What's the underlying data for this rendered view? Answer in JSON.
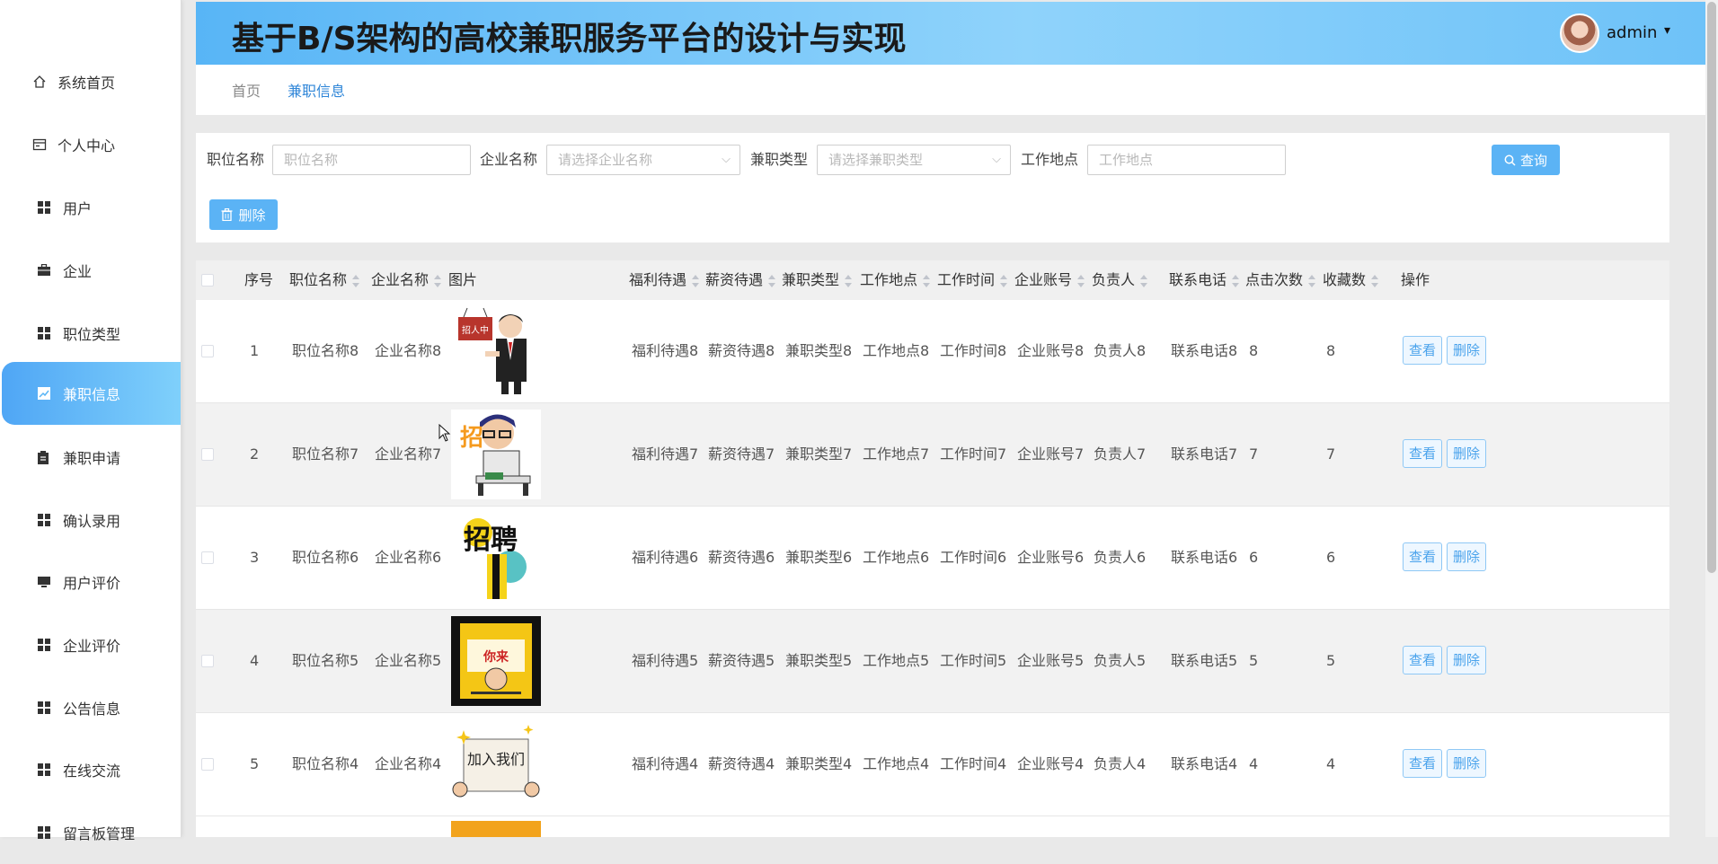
{
  "header": {
    "title": "基于B/S架构的高校兼职服务平台的设计与实现",
    "user": "admin",
    "caret": "▾"
  },
  "sidebar": {
    "items": [
      {
        "label": "系统首页",
        "icon": "home-icon"
      },
      {
        "label": "个人中心",
        "icon": "profile-card-icon"
      },
      {
        "label": "用户",
        "icon": "grid-icon"
      },
      {
        "label": "企业",
        "icon": "briefcase-icon"
      },
      {
        "label": "职位类型",
        "icon": "grid-icon"
      },
      {
        "label": "兼职信息",
        "icon": "chart-icon",
        "active": true
      },
      {
        "label": "兼职申请",
        "icon": "clipboard-icon"
      },
      {
        "label": "确认录用",
        "icon": "grid-icon"
      },
      {
        "label": "用户评价",
        "icon": "monitor-icon"
      },
      {
        "label": "企业评价",
        "icon": "grid-icon"
      },
      {
        "label": "公告信息",
        "icon": "grid-icon"
      },
      {
        "label": "在线交流",
        "icon": "grid-icon"
      },
      {
        "label": "留言板管理",
        "icon": "grid-icon"
      }
    ]
  },
  "breadcrumb": {
    "home": "首页",
    "current": "兼职信息"
  },
  "search": {
    "job_name_label": "职位名称",
    "job_name_placeholder": "职位名称",
    "company_label": "企业名称",
    "company_placeholder": "请选择企业名称",
    "type_label": "兼职类型",
    "type_placeholder": "请选择兼职类型",
    "location_label": "工作地点",
    "location_placeholder": "工作地点",
    "query_button": "查询",
    "delete_button": "删除"
  },
  "table": {
    "columns": [
      "序号",
      "职位名称",
      "企业名称",
      "图片",
      "福利待遇",
      "薪资待遇",
      "兼职类型",
      "工作地点",
      "工作时间",
      "企业账号",
      "负责人",
      "联系电话",
      "点击次数",
      "收藏数",
      "操作"
    ],
    "view_label": "查看",
    "delete_label": "删除",
    "rows": [
      {
        "index": "1",
        "job": "职位名称8",
        "company": "企业名称8",
        "image": "businessman-hiring-sign",
        "welfare": "福利待遇8",
        "salary": "薪资待遇8",
        "type": "兼职类型8",
        "location": "工作地点8",
        "time": "工作时间8",
        "account": "企业账号8",
        "manager": "负责人8",
        "phone": "联系电话8",
        "clicks": "8",
        "favorites": "8"
      },
      {
        "index": "2",
        "job": "职位名称7",
        "company": "企业名称7",
        "image": "recruit-man-laptop",
        "welfare": "福利待遇7",
        "salary": "薪资待遇7",
        "type": "兼职类型7",
        "location": "工作地点7",
        "time": "工作时间7",
        "account": "企业账号7",
        "manager": "负责人7",
        "phone": "联系电话7",
        "clicks": "7",
        "favorites": "7"
      },
      {
        "index": "3",
        "job": "职位名称6",
        "company": "企业名称6",
        "image": "recruit-calligraphy",
        "welfare": "福利待遇6",
        "salary": "薪资待遇6",
        "type": "兼职类型6",
        "location": "工作地点6",
        "time": "工作时间6",
        "account": "企业账号6",
        "manager": "负责人6",
        "phone": "联系电话6",
        "clicks": "6",
        "favorites": "6"
      },
      {
        "index": "4",
        "job": "职位名称5",
        "company": "企业名称5",
        "image": "yellow-recruit-poster",
        "welfare": "福利待遇5",
        "salary": "薪资待遇5",
        "type": "兼职类型5",
        "location": "工作地点5",
        "time": "工作时间5",
        "account": "企业账号5",
        "manager": "负责人5",
        "phone": "联系电话5",
        "clicks": "5",
        "favorites": "5"
      },
      {
        "index": "5",
        "job": "职位名称4",
        "company": "企业名称4",
        "image": "join-us-banner",
        "welfare": "福利待遇4",
        "salary": "薪资待遇4",
        "type": "兼职类型4",
        "location": "工作地点4",
        "time": "工作时间4",
        "account": "企业账号4",
        "manager": "负责人4",
        "phone": "联系电话4",
        "clicks": "4",
        "favorites": "4"
      }
    ]
  },
  "images": {
    "hiring_sign_text": "招人中",
    "recruit_text": "招",
    "recruit_big_text": "招聘",
    "poster_text": "你来",
    "join_text": "加入我们"
  },
  "colors": {
    "accent": "#5bb3f5",
    "header_start": "#58b5f6",
    "header_end": "#8fd3fb",
    "link": "#2f86d8"
  }
}
